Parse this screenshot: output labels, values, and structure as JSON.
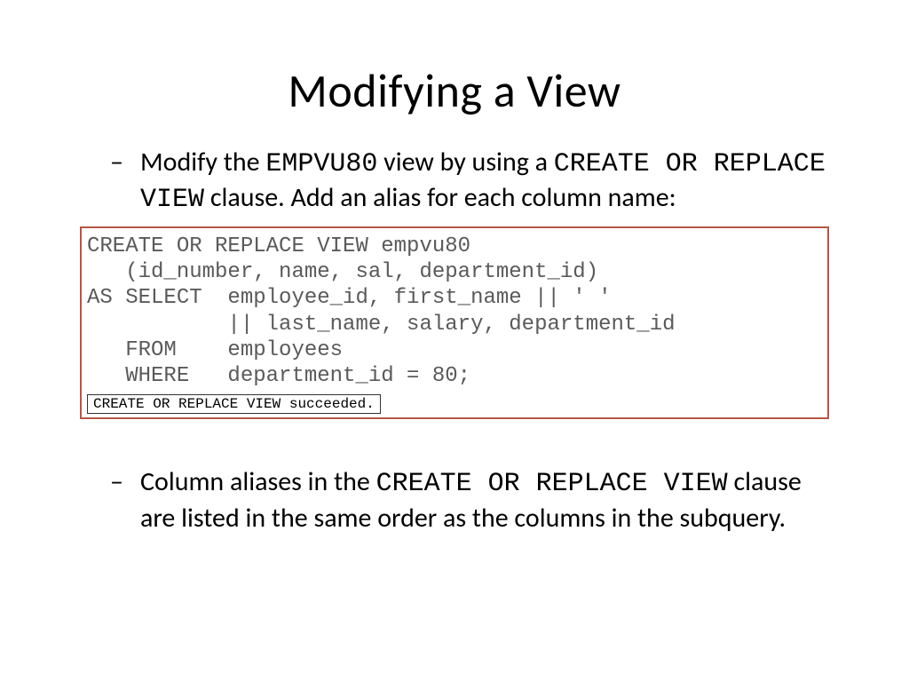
{
  "title": "Modifying a View",
  "bullets": [
    {
      "parts": [
        "Modify the ",
        "EMPVU80",
        " view by using a ",
        "CREATE OR REPLACE VIEW",
        " clause. Add an alias for each column name:"
      ]
    },
    {
      "parts": [
        "Column aliases in the ",
        "CREATE OR REPLACE VIEW",
        " clause are listed in the same order as the columns in the subquery."
      ]
    }
  ],
  "code": "CREATE OR REPLACE VIEW empvu80\n   (id_number, name, sal, department_id)\nAS SELECT  employee_id, first_name || ' ' \n           || last_name, salary, department_id\n   FROM    employees\n   WHERE   department_id = 80;",
  "status": "CREATE OR REPLACE VIEW succeeded."
}
